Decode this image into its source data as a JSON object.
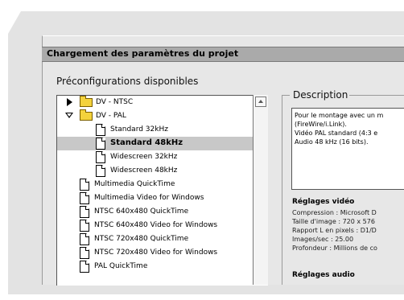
{
  "window": {
    "title": "Chargement des paramètres du projet"
  },
  "presets": {
    "label": "Préconfigurations disponibles",
    "items": [
      {
        "label": "DV - NTSC",
        "type": "folder",
        "expanded": false
      },
      {
        "label": "DV - PAL",
        "type": "folder",
        "expanded": true
      },
      {
        "label": "Standard 32kHz",
        "type": "file"
      },
      {
        "label": "Standard 48kHz",
        "type": "file",
        "selected": true
      },
      {
        "label": "Widescreen 32kHz",
        "type": "file"
      },
      {
        "label": "Widescreen 48kHz",
        "type": "file"
      },
      {
        "label": "Multimedia QuickTime",
        "type": "file"
      },
      {
        "label": "Multimedia Video for Windows",
        "type": "file"
      },
      {
        "label": "NTSC 640x480 QuickTime",
        "type": "file"
      },
      {
        "label": "NTSC 640x480 Video for Windows",
        "type": "file"
      },
      {
        "label": "NTSC 720x480 QuickTime",
        "type": "file"
      },
      {
        "label": "NTSC 720x480 Video for Windows",
        "type": "file"
      },
      {
        "label": "PAL QuickTime",
        "type": "file"
      }
    ]
  },
  "description": {
    "label": "Description",
    "text": "Pour le montage avec un m\n(FireWire/i.Link).\nVidéo PAL standard (4:3 e\nAudio 48 kHz (16 bits)."
  },
  "video_settings": {
    "title": "Réglages vidéo",
    "lines": "Compression : Microsoft D\nTaille d'image : 720 x 576\nRapport L en pixels : D1/D\nImages/sec : 25.00\nProfondeur : Millions de co"
  },
  "audio_settings": {
    "title": "Réglages audio"
  },
  "colors": {
    "selection": "#c8c8c8",
    "titlebar": "#aaaaaa",
    "folder": "#f4d23c"
  }
}
